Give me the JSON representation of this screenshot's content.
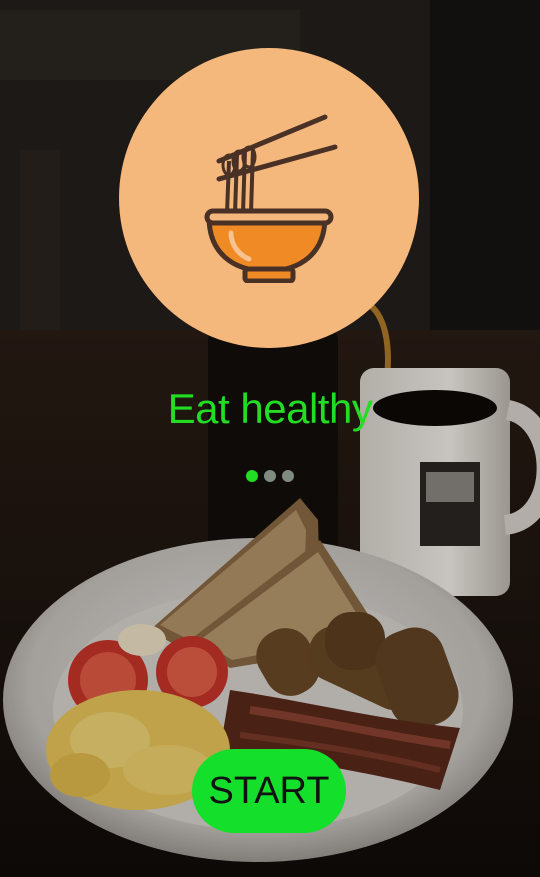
{
  "onboarding": {
    "headline": "Eat healthy",
    "start_label": "START",
    "icon": "noodle-bowl-icon",
    "page_count": 3,
    "active_page": 1
  },
  "colors": {
    "accent": "#22dd22",
    "button_bg": "#14e02c",
    "icon_circle": "#f5b87c",
    "icon_bowl": "#f08a24",
    "icon_stroke": "#4a3126",
    "dot_active": "#22dd22",
    "dot_inactive": "#7f8a80"
  }
}
